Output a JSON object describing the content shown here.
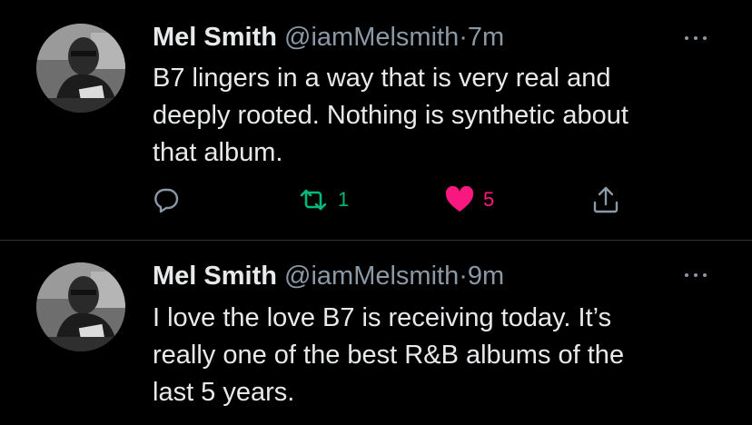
{
  "tweets": [
    {
      "author_name": "Mel Smith",
      "handle": "@iamMelsmith",
      "separator": "·",
      "time": "7m",
      "lines": [
        "B7 lingers in a way that is very real and",
        "deeply rooted. Nothing is synthetic about",
        "that album."
      ],
      "retweets": "1",
      "likes": "5",
      "liked": true,
      "retweeted": true,
      "icons": [
        "reply-icon",
        "retweet-icon",
        "heart-icon",
        "share-icon",
        "more-icon"
      ]
    },
    {
      "author_name": "Mel Smith",
      "handle": "@iamMelsmith",
      "separator": "·",
      "time": "9m",
      "lines": [
        "I love the love B7 is receiving today. It’s",
        "really one of the best R&B albums of the",
        "last 5 years."
      ],
      "icons": [
        "more-icon"
      ]
    }
  ],
  "colors": {
    "background": "#000000",
    "text": "#e7e9ea",
    "muted": "#8b98a5",
    "retweet_green": "#00ba7c",
    "like_pink": "#f91880",
    "divider": "#2f3336"
  }
}
